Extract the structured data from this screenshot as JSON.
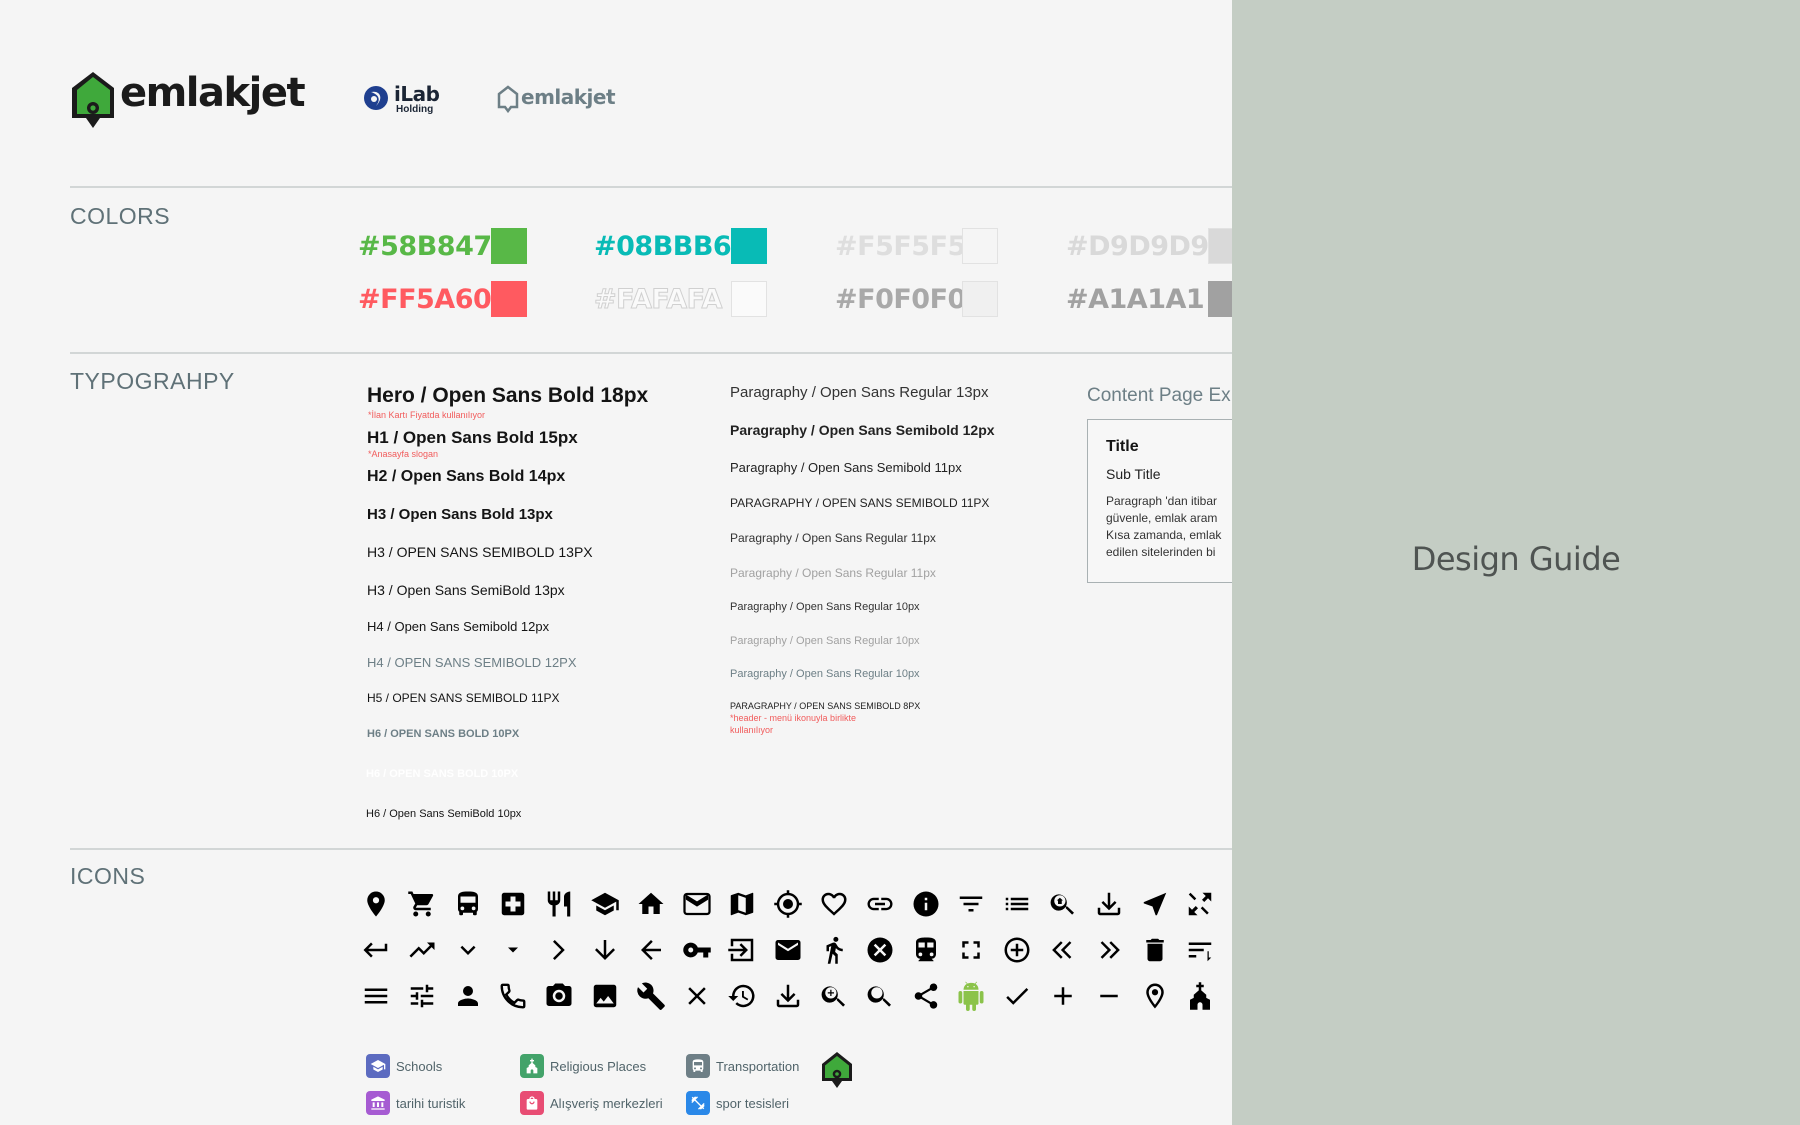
{
  "brand": {
    "main_logo": "emlakjet",
    "ilab_name": "iLab",
    "ilab_sub": "Holding",
    "small_logo": "emlakjet",
    "green": "#3fa93b"
  },
  "sections": {
    "colors": "COLORS",
    "typography": "TYPOGRAHPY",
    "icons": "ICONS"
  },
  "colors": [
    {
      "label": "#58B847",
      "hex": "#58B847"
    },
    {
      "label": "#08BBB6",
      "hex": "#08BBB6"
    },
    {
      "label": "#F5F5F5",
      "hex": "#F5F5F5"
    },
    {
      "label": "#D9D9D9",
      "hex": "#D9D9D9"
    },
    {
      "label": "#FF5A60",
      "hex": "#FF5A60"
    },
    {
      "label": "#FAFAFA",
      "hex": "#FAFAFA"
    },
    {
      "label": "#F0F0F0",
      "hex": "#F0F0F0"
    },
    {
      "label": "#A1A1A1",
      "hex": "#A1A1A1"
    }
  ],
  "typography": {
    "left": [
      "Hero / Open Sans Bold 18px",
      "H1 / Open Sans Bold 15px",
      "H2 / Open Sans Bold 14px",
      "H3 / Open Sans Bold 13px",
      "H3 / OPEN SANS SEMIBOLD 13PX",
      "H3 / Open Sans SemiBold 13px",
      "H4 / Open Sans Semibold 12px",
      "H4 / OPEN SANS SEMIBOLD 12PX",
      "H5 / OPEN SANS SEMIBOLD 11PX",
      "H6 / OPEN SANS BOLD 10PX",
      "H6 / OPEN SANS BOLD 10PX",
      "H6 / Open Sans SemiBold 10px"
    ],
    "hero_note": "*İlan Kartı Fiyatda kullanılıyor",
    "h1_note": "*Anasayfa slogan",
    "middle": [
      "Paragraphy / Open Sans Regular 13px",
      "Paragraphy / Open Sans Semibold 12px",
      "Paragraphy / Open Sans Semibold 11px",
      "PARAGRAPHY / OPEN SANS SEMIBOLD 11PX",
      "Paragraphy / Open Sans Regular 11px",
      "Paragraphy / Open Sans Regular 11px",
      "Paragraphy / Open Sans Regular 10px",
      "Paragraphy / Open Sans Regular 10px",
      "Paragraphy / Open Sans Regular 10px",
      "PARAGRAPHY / OPEN SANS SEMIBOLD 8PX"
    ],
    "p8_note_1": "*header - menü ikonuyla birlikte",
    "p8_note_2": "kullanılıyor",
    "example": {
      "heading": "Content Page Ex",
      "title": "Title",
      "subtitle": "Sub Title",
      "lines": [
        "Paragraph 'dan itibar",
        "güvenle, emlak aram",
        "Kısa zamanda, emlak",
        "edilen sitelerinden bi"
      ]
    }
  },
  "icons": [
    [
      "pin-icon",
      "cart-icon",
      "bus-icon",
      "hospital-icon",
      "restaurant-icon",
      "school-icon",
      "home-icon",
      "mail-outline-icon",
      "map-icon",
      "gps-icon",
      "heart-icon",
      "link-icon",
      "info-icon",
      "filter-icon",
      "list-icon",
      "zoom-home-icon",
      "download-icon",
      "navigate-icon",
      "expand-arrows-icon"
    ],
    [
      "return-icon",
      "trending-icon",
      "chevron-down-icon",
      "caret-down-icon",
      "chevron-right-icon",
      "arrow-down-icon",
      "arrow-left-icon",
      "key-icon",
      "login-icon",
      "mail-icon",
      "walk-icon",
      "close-circle-icon",
      "train-icon",
      "fullscreen-icon",
      "add-circle-icon",
      "double-left-icon",
      "double-right-icon",
      "trash-icon",
      "sort-icon"
    ],
    [
      "menu-icon",
      "tune-icon",
      "person-icon",
      "phone-icon",
      "camera-icon",
      "image-icon",
      "wrench-icon",
      "close-icon",
      "history-icon",
      "download-icon",
      "zoom-in-icon",
      "search-icon",
      "share-icon",
      "android-icon",
      "check-icon",
      "plus-icon",
      "minus-icon",
      "pin-outline-icon",
      "church-icon"
    ]
  ],
  "poi": [
    {
      "label": "Schools",
      "color": "#5c6bc0",
      "icon": "school-icon"
    },
    {
      "label": "Religious Places",
      "color": "#43a36a",
      "icon": "church-icon"
    },
    {
      "label": "Transportation",
      "color": "#6e7f86",
      "icon": "bus-icon"
    },
    {
      "label": "tarihi turistik",
      "color": "#a65bd2",
      "icon": "museum-icon"
    },
    {
      "label": "Alışveriş merkezleri",
      "color": "#e84d74",
      "icon": "bag-icon"
    },
    {
      "label": "spor tesisleri",
      "color": "#2a88e8",
      "icon": "sport-icon"
    }
  ],
  "side": {
    "title": "Design Guide"
  }
}
